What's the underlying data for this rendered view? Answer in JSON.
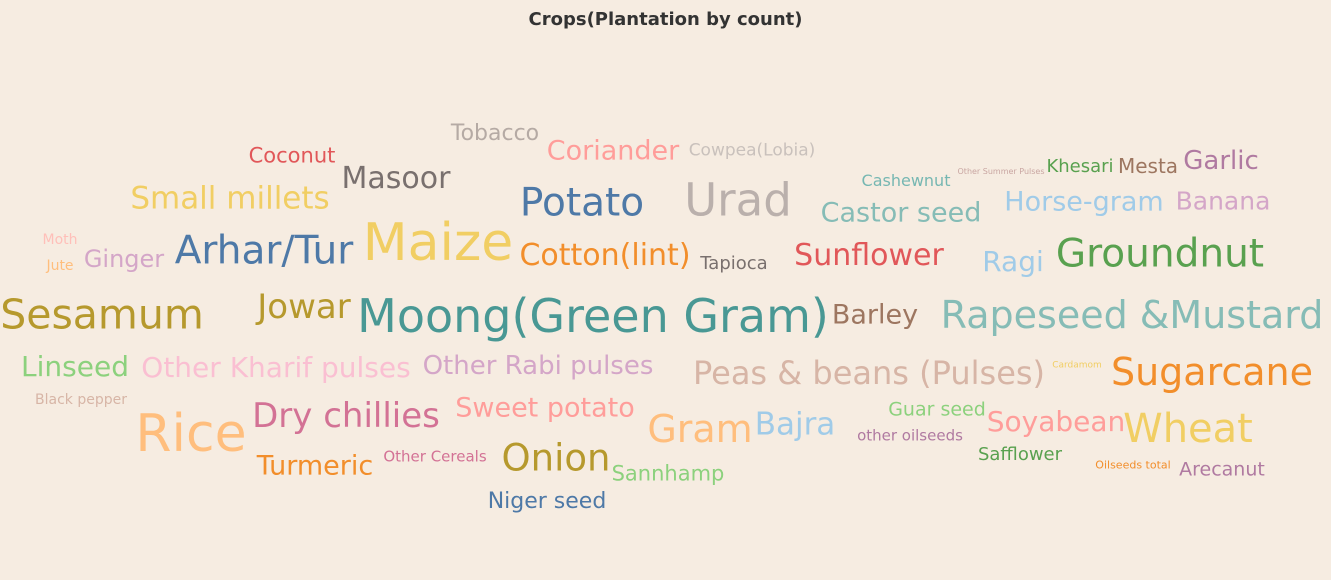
{
  "chart_data": {
    "type": "wordcloud",
    "title": "Crops(Plantation by count)",
    "words": [
      {
        "text": "Tobacco",
        "color": "#b5aaa4"
      },
      {
        "text": "Coconut",
        "color": "#e15759"
      },
      {
        "text": "Coriander",
        "color": "#ff9d9a"
      },
      {
        "text": "Cowpea(Lobia)",
        "color": "#c9c1bc"
      },
      {
        "text": "Masoor",
        "color": "#79706e"
      },
      {
        "text": "Cashewnut",
        "color": "#76b7b2"
      },
      {
        "text": "Other Summer Pulses",
        "color": "#c9a6a2"
      },
      {
        "text": "Khesari",
        "color": "#59a14f"
      },
      {
        "text": "Mesta",
        "color": "#9d7660"
      },
      {
        "text": "Garlic",
        "color": "#b07aa1"
      },
      {
        "text": "Small millets",
        "color": "#f1ce63"
      },
      {
        "text": "Potato",
        "color": "#4e79a7"
      },
      {
        "text": "Urad",
        "color": "#bab0ac"
      },
      {
        "text": "Castor seed",
        "color": "#86bcb6"
      },
      {
        "text": "Horse-gram",
        "color": "#a0cbe8"
      },
      {
        "text": "Banana",
        "color": "#d4a6c8"
      },
      {
        "text": "Moth",
        "color": "#ffbfb9"
      },
      {
        "text": "Jute",
        "color": "#ffbe7d"
      },
      {
        "text": "Ginger",
        "color": "#d4a6c8"
      },
      {
        "text": "Arhar/Tur",
        "color": "#4e79a7"
      },
      {
        "text": "Maize",
        "color": "#f1ce63"
      },
      {
        "text": "Cotton(lint)",
        "color": "#f28e2b"
      },
      {
        "text": "Tapioca",
        "color": "#79706e"
      },
      {
        "text": "Sunflower",
        "color": "#e15759"
      },
      {
        "text": "Ragi",
        "color": "#a0cbe8"
      },
      {
        "text": "Groundnut",
        "color": "#59a14f"
      },
      {
        "text": "Sesamum",
        "color": "#b6992d"
      },
      {
        "text": "Jowar",
        "color": "#b6992d"
      },
      {
        "text": "Moong(Green Gram)",
        "color": "#499894"
      },
      {
        "text": "Barley",
        "color": "#9d7660"
      },
      {
        "text": "Rapeseed &Mustard",
        "color": "#86bcb6"
      },
      {
        "text": "Linseed",
        "color": "#8cd17d"
      },
      {
        "text": "Other Kharif pulses",
        "color": "#fabfd2"
      },
      {
        "text": "Other Rabi pulses",
        "color": "#d4a6c8"
      },
      {
        "text": "Peas & beans (Pulses)",
        "color": "#d7b5a6"
      },
      {
        "text": "Cardamom",
        "color": "#f1ce63"
      },
      {
        "text": "Sugarcane",
        "color": "#f28e2b"
      },
      {
        "text": "Black pepper",
        "color": "#d7b5a6"
      },
      {
        "text": "Rice",
        "color": "#ffbe7d"
      },
      {
        "text": "Dry chillies",
        "color": "#d37295"
      },
      {
        "text": "Sweet potato",
        "color": "#ff9d9a"
      },
      {
        "text": "Gram",
        "color": "#ffbe7d"
      },
      {
        "text": "Bajra",
        "color": "#a0cbe8"
      },
      {
        "text": "Guar seed",
        "color": "#8cd17d"
      },
      {
        "text": "other oilseeds",
        "color": "#b07aa1"
      },
      {
        "text": "Soyabean",
        "color": "#ff9d9a"
      },
      {
        "text": "Wheat",
        "color": "#f1ce63"
      },
      {
        "text": "Turmeric",
        "color": "#f28e2b"
      },
      {
        "text": "Other Cereals",
        "color": "#d37295"
      },
      {
        "text": "Onion",
        "color": "#b6992d"
      },
      {
        "text": "Sannhamp",
        "color": "#8cd17d"
      },
      {
        "text": "Safflower",
        "color": "#59a14f"
      },
      {
        "text": "Oilseeds total",
        "color": "#f28e2b"
      },
      {
        "text": "Arecanut",
        "color": "#b07aa1"
      },
      {
        "text": "Niger seed",
        "color": "#4e79a7"
      }
    ]
  }
}
